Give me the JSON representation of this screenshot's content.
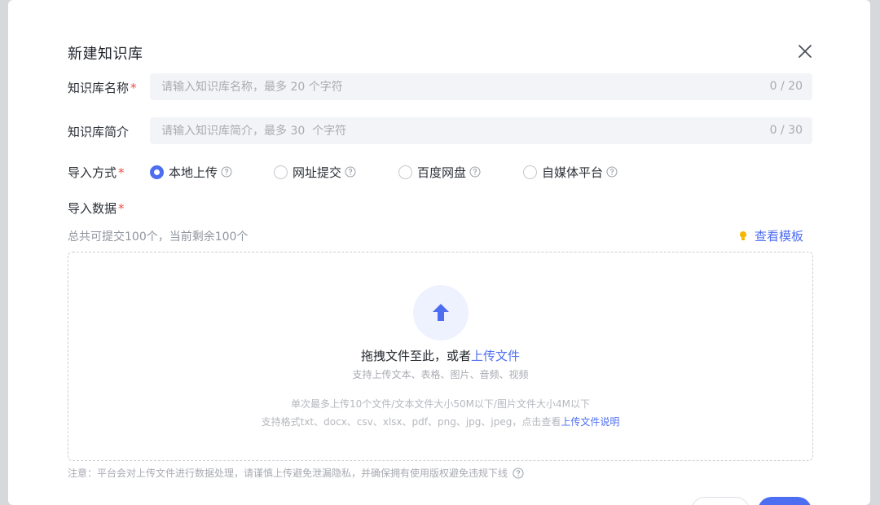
{
  "dialog": {
    "title": "新建知识库",
    "close_icon": "close-icon"
  },
  "name_field": {
    "label": "知识库名称",
    "required_mark": "*",
    "placeholder": "请输入知识库名称，最多 20 个字符",
    "value": "",
    "counter": "0 / 20"
  },
  "intro_field": {
    "label": "知识库简介",
    "placeholder": "请输入知识库简介，最多 30  个字符",
    "value": "",
    "counter": "0 / 30"
  },
  "import_method": {
    "label": "导入方式",
    "required_mark": "*",
    "selected": "本地上传",
    "options": [
      {
        "label": "本地上传",
        "checked": true
      },
      {
        "label": "网址提交",
        "checked": false
      },
      {
        "label": "百度网盘",
        "checked": false
      },
      {
        "label": "自媒体平台",
        "checked": false
      }
    ]
  },
  "import_data": {
    "label": "导入数据",
    "required_mark": "*",
    "quota_text": "总共可提交100个，当前剩余100个",
    "template_link": "查看模板",
    "bulb_icon": "lightbulb-icon"
  },
  "dropzone": {
    "upload_icon": "upload-arrow-icon",
    "main_text": "拖拽文件至此，或者",
    "main_link": "上传文件",
    "sub_text": "支持上传文本、表格、图片、音频、视频",
    "limit_text": "单次最多上传10个文件/文本文件大小50M以下/图片文件大小4M以下",
    "formats_text": "支持格式txt、docx、csv、xlsx、pdf、png、jpg、jpeg，点击查看",
    "formats_link": "上传文件说明"
  },
  "notice": "注意：平台会对上传文件进行数据处理，请谨慎上传避免泄漏隐私，并确保拥有使用版权避免违规下线",
  "colors": {
    "accent": "#4e6ef2",
    "required": "#f54a45",
    "field_bg": "#f3f4f7",
    "muted_text": "#a8abb2"
  }
}
